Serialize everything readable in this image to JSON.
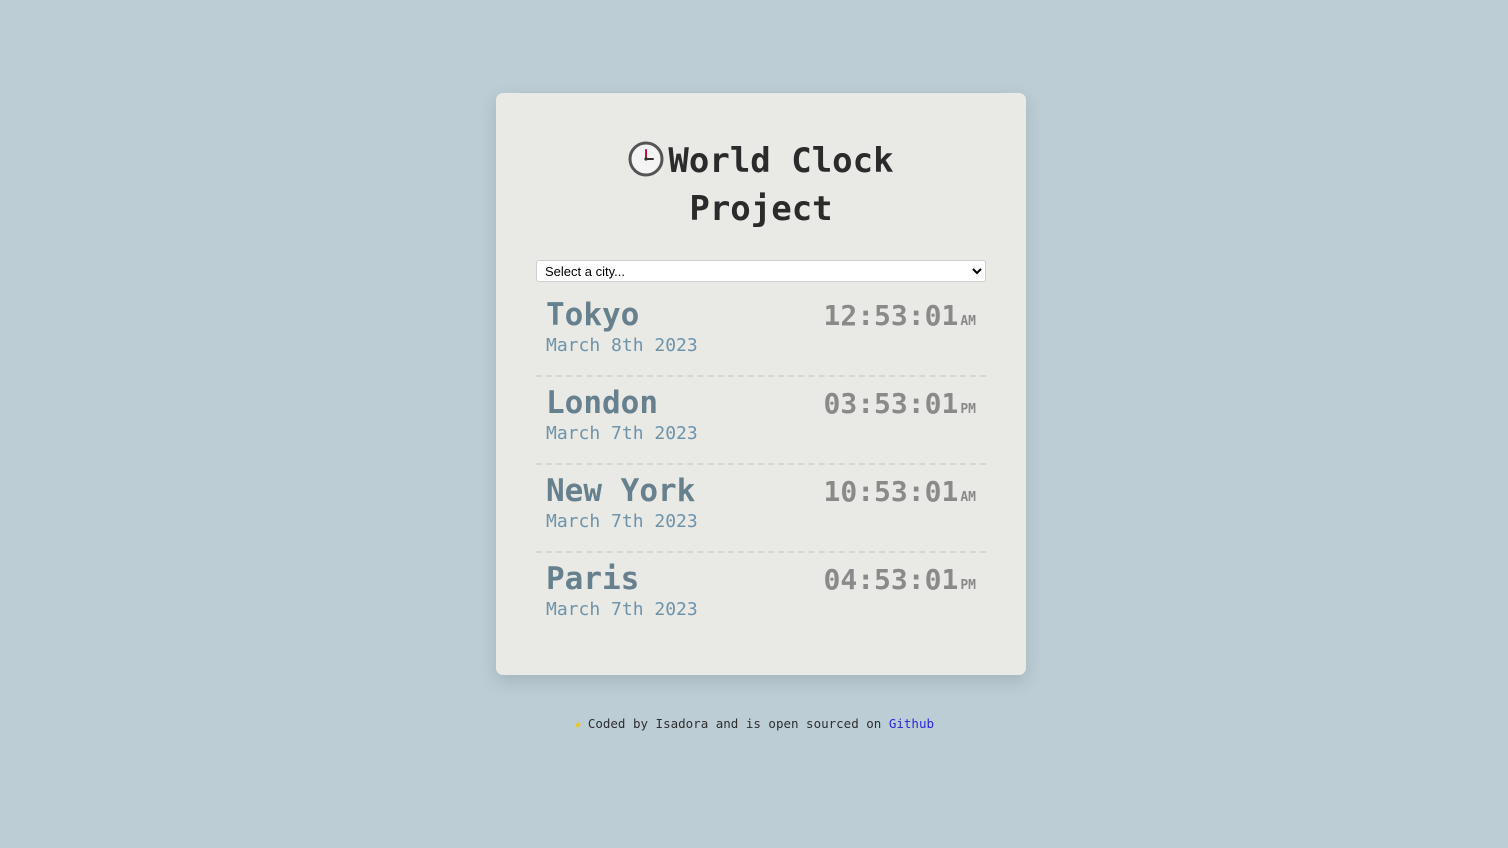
{
  "app": {
    "title": "World Clock Project",
    "icon": "clock-icon"
  },
  "select": {
    "placeholder": "Select a city..."
  },
  "cities": [
    {
      "name": "Tokyo",
      "date": "March 8th 2023",
      "time": "12:53:01",
      "ampm": "AM"
    },
    {
      "name": "London",
      "date": "March 7th 2023",
      "time": "03:53:01",
      "ampm": "PM"
    },
    {
      "name": "New York",
      "date": "March 7th 2023",
      "time": "10:53:01",
      "ampm": "AM"
    },
    {
      "name": "Paris",
      "date": "March 7th 2023",
      "time": "04:53:01",
      "ampm": "PM"
    }
  ],
  "footer": {
    "icon": "star-icon",
    "text": "Coded by Isadora and is open sourced on ",
    "link_label": "Github"
  },
  "colors": {
    "background": "#bccdd5",
    "card": "#e9e9e5",
    "city_name": "#66808e",
    "city_date": "#6f93a8",
    "time": "#8a8a8a",
    "link": "#2626d8"
  }
}
